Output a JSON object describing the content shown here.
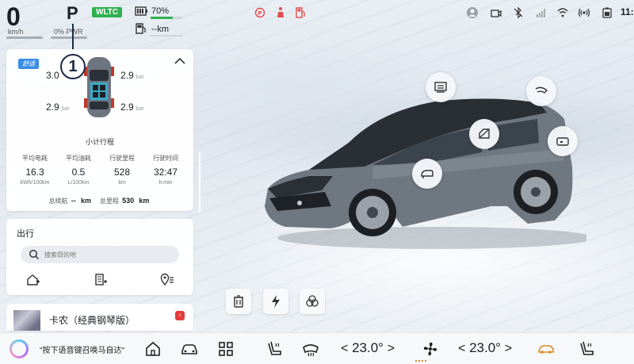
{
  "status_bar": {
    "speed": "0",
    "speed_unit": "km/h",
    "gear": "P",
    "power_label": "0% PWR",
    "callout_number": "1",
    "range_standard": "WLTC",
    "battery_percent": "70%",
    "battery_fraction": 0.7,
    "fuel_range": "--km",
    "clock": "11:"
  },
  "tire_card": {
    "mode_badge": "舒适",
    "tires": {
      "front_left": "3.0",
      "front_right": "2.9",
      "rear_left": "2.9",
      "rear_right": "2.9",
      "unit": "bar"
    },
    "trip_title": "小计行程",
    "stats": [
      {
        "label": "平均电耗",
        "value": "16.3",
        "unit": "kWh/100km"
      },
      {
        "label": "平均油耗",
        "value": "0.5",
        "unit": "L/100km"
      },
      {
        "label": "行驶里程",
        "value": "528",
        "unit": "km"
      },
      {
        "label": "行驶时间",
        "value": "32:47",
        "unit": "h:min"
      }
    ],
    "totals": {
      "total_range_label": "总续航",
      "total_range_value": "--",
      "total_range_unit": "km",
      "odometer_label": "总里程",
      "odometer_value": "530",
      "odometer_unit": "km"
    }
  },
  "navigation": {
    "title": "出行",
    "search_placeholder": "搜索目的地"
  },
  "music": {
    "song": "卡农（经典钢琴版）"
  },
  "dock": {
    "voice_hint": "\"按下语音键召唤马自达\"",
    "left_temp": "23.0°",
    "right_temp": "23.0°",
    "arrow_left": "<",
    "arrow_right": ">"
  },
  "colors": {
    "wltc_green": "#2fb14f",
    "warning_red": "#e24b4b",
    "mode_blue": "#3a8ee6",
    "callout_navy": "#1b2a44"
  },
  "icons": [
    "battery-icon",
    "fuel-icon",
    "parking-brake-warning-icon",
    "seatbelt-warning-icon",
    "fuel-warning-icon",
    "avatar-icon",
    "dashcam-icon",
    "bluetooth-off-icon",
    "cellular-icon",
    "wifi-icon",
    "hotspot-icon",
    "collapse-icon",
    "search-icon",
    "home-icon",
    "car-icon",
    "apps-icon",
    "seat-heat-icon",
    "defrost-icon",
    "fan-icon"
  ]
}
